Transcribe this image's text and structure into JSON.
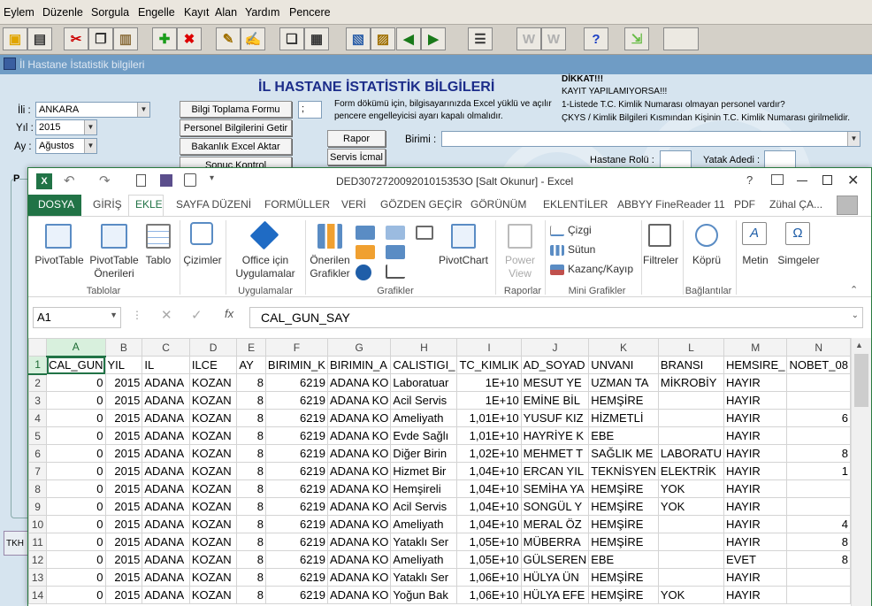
{
  "menubar": {
    "items": [
      "Eylem",
      "Düzenle",
      "Sorgula",
      "Engelle",
      "Kayıt",
      "Alan",
      "Yardım",
      "Pencere"
    ]
  },
  "toolbar": {
    "icons": [
      "save-icon",
      "print-icon",
      "cut-icon",
      "copy-icon",
      "paste-icon",
      "insert-record-icon",
      "delete-record-icon",
      "edit-icon",
      "edit-field-icon",
      "duplicate-icon",
      "form-icon",
      "query-icon",
      "chart-icon",
      "previous-icon",
      "next-icon",
      "list-values-icon",
      "disabled-icon",
      "disabled-icon",
      "help-icon",
      "exit-icon"
    ]
  },
  "form": {
    "window_title": "İl Hastane İstatistik bilgileri",
    "title": "İL HASTANE İSTATİSTİK BİLGİLERİ",
    "il_label": "İli :",
    "il_value": "ANKARA",
    "yil_label": "Yıl :",
    "yil_value": "2015",
    "ay_label": "Ay :",
    "ay_value": "Ağustos",
    "btn_bilgi": "Bilgi Toplama Formu",
    "btn_personel": "Personel Bilgilerini Getir",
    "btn_bakanlik": "Bakanlık Excel Aktar",
    "btn_sonuc": "Sonuç Kontrol",
    "small_field": ";",
    "note": "Form dökümü için, bilgisayarınızda Excel yüklü ve açılır pencere engelleyicisi ayarı kapalı olmalıdır.",
    "btn_rapor": "Rapor",
    "btn_servis": "Servis İcmal",
    "birimi_label": "Birimi :",
    "birimi_value": "",
    "dikkat_title": "DİKKAT!!!",
    "dikkat_1": "KAYIT YAPILAMIYORSA!!!",
    "dikkat_2": "1-Listede T.C. Kimlik Numarası olmayan personel vardır?",
    "dikkat_3": "ÇKYS / Kimlik Bilgileri Kısmından Kişinin T.C. Kimlik Numarası girilmelidir.",
    "hastane_rolu_label": "Hastane Rolü :",
    "yatak_adedi_label": "Yatak Adedi :",
    "bottom_tab": "TKH",
    "frame_label": "P"
  },
  "excel": {
    "window_title": "DED307272009201015353O  [Salt Okunur] - Excel",
    "help": "?",
    "user": "Zühal ÇA...",
    "tabs": [
      "DOSYA",
      "GİRİŞ",
      "EKLE",
      "SAYFA DÜZENİ",
      "FORMÜLLER",
      "VERİ",
      "GÖZDEN GEÇİR",
      "GÖRÜNÜM",
      "EKLENTİLER",
      "ABBYY FineReader 11",
      "PDF"
    ],
    "active_tab": "EKLE",
    "ribbon": {
      "pivottable": "PivotTable",
      "pivottable_oneri": "PivotTable Önerileri",
      "tablo": "Tablo",
      "group_tablolar": "Tablolar",
      "cizimler": "Çizimler",
      "office": "Office için Uygulamalar",
      "group_uygulamalar": "Uygulamalar",
      "onerilen": "Önerilen Grafikler",
      "group_grafikler": "Grafikler",
      "pivotchart": "PivotChart",
      "powerview": "Power View",
      "group_raporlar": "Raporlar",
      "cizgi": "Çizgi",
      "sutun": "Sütun",
      "kazanc": "Kazanç/Kayıp",
      "group_mini": "Mini Grafikler",
      "filtreler": "Filtreler",
      "kopru": "Köprü",
      "group_baglantilar": "Bağlantılar",
      "metin": "Metin",
      "simgeler": "Simgeler"
    },
    "name_box": "A1",
    "formula": "CAL_GUN_SAY",
    "columns": [
      "A",
      "B",
      "C",
      "D",
      "E",
      "F",
      "G",
      "H",
      "I",
      "J",
      "K",
      "L",
      "M",
      "N"
    ],
    "rows": [
      {
        "n": "1",
        "cells": [
          "CAL_GUN",
          "YIL",
          "IL",
          "ILCE",
          "AY",
          "BIRIMIN_K",
          "BIRIMIN_A",
          "CALISTIGI_",
          "TC_KIMLIK",
          "AD_SOYAD",
          "UNVANI",
          "BRANSI",
          "HEMSIRE_",
          "NOBET_08"
        ]
      },
      {
        "n": "2",
        "cells": [
          "0",
          "2015",
          "ADANA",
          "KOZAN",
          "8",
          "6219",
          "ADANA KO",
          "Laboratuar",
          "1E+10",
          "MESUT YE",
          "UZMAN TA",
          "MİKROBİY",
          "HAYIR",
          ""
        ]
      },
      {
        "n": "3",
        "cells": [
          "0",
          "2015",
          "ADANA",
          "KOZAN",
          "8",
          "6219",
          "ADANA KO",
          "Acil Servis",
          "1E+10",
          "EMİNE BİL",
          "HEMŞİRE",
          "",
          "HAYIR",
          ""
        ]
      },
      {
        "n": "4",
        "cells": [
          "0",
          "2015",
          "ADANA",
          "KOZAN",
          "8",
          "6219",
          "ADANA KO",
          "Ameliyath",
          "1,01E+10",
          "YUSUF KIZ",
          "HİZMETLİ",
          "",
          "HAYIR",
          "6"
        ]
      },
      {
        "n": "5",
        "cells": [
          "0",
          "2015",
          "ADANA",
          "KOZAN",
          "8",
          "6219",
          "ADANA KO",
          "Evde Sağlı",
          "1,01E+10",
          "HAYRİYE K",
          "EBE",
          "",
          "HAYIR",
          ""
        ]
      },
      {
        "n": "6",
        "cells": [
          "0",
          "2015",
          "ADANA",
          "KOZAN",
          "8",
          "6219",
          "ADANA KO",
          "Diğer Birin",
          "1,02E+10",
          "MEHMET T",
          "SAĞLIK ME",
          "LABORATU",
          "HAYIR",
          "8"
        ]
      },
      {
        "n": "7",
        "cells": [
          "0",
          "2015",
          "ADANA",
          "KOZAN",
          "8",
          "6219",
          "ADANA KO",
          "Hizmet Bir",
          "1,04E+10",
          "ERCAN YIL",
          "TEKNİSYEN",
          "ELEKTRİK",
          "HAYIR",
          "1"
        ]
      },
      {
        "n": "8",
        "cells": [
          "0",
          "2015",
          "ADANA",
          "KOZAN",
          "8",
          "6219",
          "ADANA KO",
          "Hemşireli",
          "1,04E+10",
          "SEMİHA YA",
          "HEMŞİRE",
          "YOK",
          "HAYIR",
          ""
        ]
      },
      {
        "n": "9",
        "cells": [
          "0",
          "2015",
          "ADANA",
          "KOZAN",
          "8",
          "6219",
          "ADANA KO",
          "Acil Servis",
          "1,04E+10",
          "SONGÜL Y",
          "HEMŞİRE",
          "YOK",
          "HAYIR",
          ""
        ]
      },
      {
        "n": "10",
        "cells": [
          "0",
          "2015",
          "ADANA",
          "KOZAN",
          "8",
          "6219",
          "ADANA KO",
          "Ameliyath",
          "1,04E+10",
          "MERAL ÖZ",
          "HEMŞİRE",
          "",
          "HAYIR",
          "4"
        ]
      },
      {
        "n": "11",
        "cells": [
          "0",
          "2015",
          "ADANA",
          "KOZAN",
          "8",
          "6219",
          "ADANA KO",
          "Yataklı Ser",
          "1,05E+10",
          "MÜBERRA",
          "HEMŞİRE",
          "",
          "HAYIR",
          "8"
        ]
      },
      {
        "n": "12",
        "cells": [
          "0",
          "2015",
          "ADANA",
          "KOZAN",
          "8",
          "6219",
          "ADANA KO",
          "Ameliyath",
          "1,05E+10",
          "GÜLSEREN",
          "EBE",
          "",
          "EVET",
          "8"
        ]
      },
      {
        "n": "13",
        "cells": [
          "0",
          "2015",
          "ADANA",
          "KOZAN",
          "8",
          "6219",
          "ADANA KO",
          "Yataklı Ser",
          "1,06E+10",
          "HÜLYA ÜN",
          "HEMŞİRE",
          "",
          "HAYIR",
          ""
        ]
      },
      {
        "n": "14",
        "cells": [
          "0",
          "2015",
          "ADANA",
          "KOZAN",
          "8",
          "6219",
          "ADANA KO",
          "Yoğun Bak",
          "1,06E+10",
          "HÜLYA EFE",
          "HEMŞİRE",
          "YOK",
          "HAYIR",
          ""
        ]
      }
    ]
  }
}
